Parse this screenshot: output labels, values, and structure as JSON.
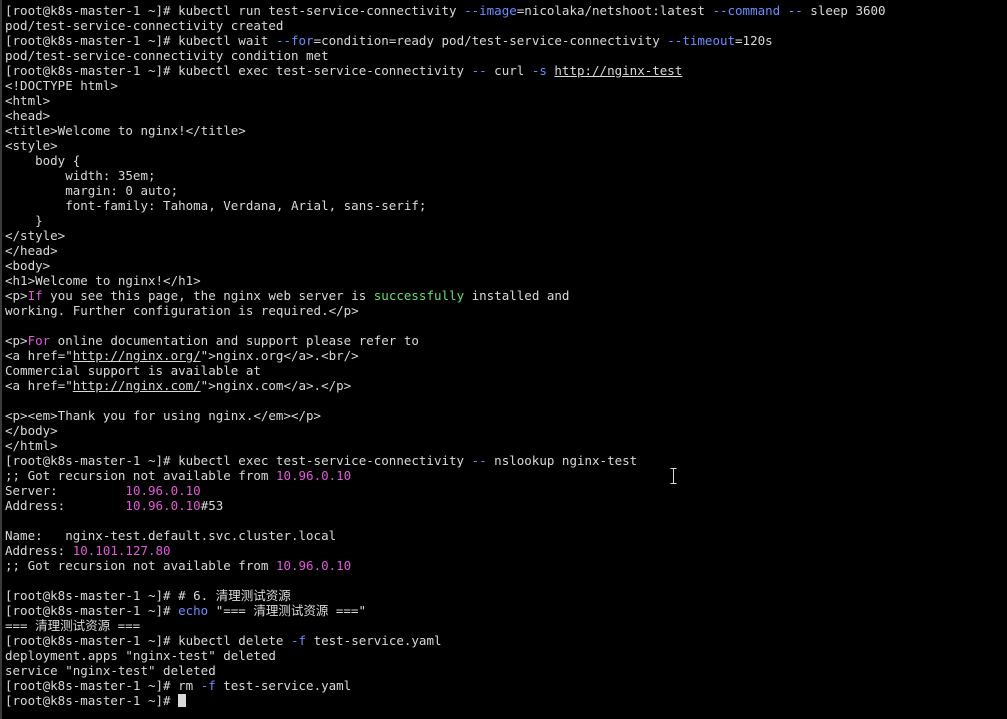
{
  "colors": {
    "background": "#000000",
    "text": "#d9d9d9",
    "option": "#6b8cff",
    "string_green": "#5fe06f",
    "magenta": "#e05ad8",
    "url": "#d9d9d9"
  },
  "icons": {
    "cursor": "text-cursor-ibeam-icon",
    "block_cursor": "terminal-block-cursor"
  },
  "terminal": {
    "lines": [
      [
        {
          "t": "[root@k8s-master-1 ~]# kubectl run test-service-connectivity "
        },
        {
          "t": "--image",
          "c": "option"
        },
        {
          "t": "=nicolaka/netshoot:latest "
        },
        {
          "t": "--command",
          "c": "option"
        },
        {
          "t": " "
        },
        {
          "t": "--",
          "c": "option"
        },
        {
          "t": " sleep 3600"
        }
      ],
      [
        {
          "t": "pod/test-service-connectivity created"
        }
      ],
      [
        {
          "t": "[root@k8s-master-1 ~]# kubectl wait "
        },
        {
          "t": "--for",
          "c": "option"
        },
        {
          "t": "=condition=ready pod/test-service-connectivity "
        },
        {
          "t": "--timeout",
          "c": "option"
        },
        {
          "t": "=120s"
        }
      ],
      [
        {
          "t": "pod/test-service-connectivity condition met"
        }
      ],
      [
        {
          "t": "[root@k8s-master-1 ~]# kubectl exec test-service-connectivity "
        },
        {
          "t": "--",
          "c": "option"
        },
        {
          "t": " curl "
        },
        {
          "t": "-s",
          "c": "option"
        },
        {
          "t": " "
        },
        {
          "t": "http://nginx-test",
          "c": "url"
        }
      ],
      [
        {
          "t": "<!DOCTYPE html>"
        }
      ],
      [
        {
          "t": "<html>"
        }
      ],
      [
        {
          "t": "<head>"
        }
      ],
      [
        {
          "t": "<title>Welcome to nginx!</title>"
        }
      ],
      [
        {
          "t": "<style>"
        }
      ],
      [
        {
          "t": "    body {"
        }
      ],
      [
        {
          "t": "        width: 35em;"
        }
      ],
      [
        {
          "t": "        margin: 0 auto;"
        }
      ],
      [
        {
          "t": "        font-family: Tahoma, Verdana, Arial, sans-serif;"
        }
      ],
      [
        {
          "t": "    }"
        }
      ],
      [
        {
          "t": "</style>"
        }
      ],
      [
        {
          "t": "</head>"
        }
      ],
      [
        {
          "t": "<body>"
        }
      ],
      [
        {
          "t": "<h1>Welcome to nginx!</h1>"
        }
      ],
      [
        {
          "t": "<p>"
        },
        {
          "t": "If",
          "c": "magenta"
        },
        {
          "t": " you see this page, the nginx web server is "
        },
        {
          "t": "successfully",
          "c": "string_green"
        },
        {
          "t": " installed and"
        }
      ],
      [
        {
          "t": "working. Further configuration is required.</p>"
        }
      ],
      [
        {
          "t": ""
        }
      ],
      [
        {
          "t": "<p>"
        },
        {
          "t": "For",
          "c": "magenta"
        },
        {
          "t": " online documentation and support please refer to"
        }
      ],
      [
        {
          "t": "<a href=\""
        },
        {
          "t": "http://nginx.org/",
          "c": "url"
        },
        {
          "t": "\">nginx.org</a>.<br/>"
        }
      ],
      [
        {
          "t": "Commercial support is available at"
        }
      ],
      [
        {
          "t": "<a href=\""
        },
        {
          "t": "http://nginx.com/",
          "c": "url"
        },
        {
          "t": "\">nginx.com</a>.</p>"
        }
      ],
      [
        {
          "t": ""
        }
      ],
      [
        {
          "t": "<p><em>Thank you for using nginx.</em></p>"
        }
      ],
      [
        {
          "t": "</body>"
        }
      ],
      [
        {
          "t": "</html>"
        }
      ],
      [
        {
          "t": "[root@k8s-master-1 ~]# kubectl exec test-service-connectivity "
        },
        {
          "t": "--",
          "c": "option"
        },
        {
          "t": " nslookup nginx-test"
        }
      ],
      [
        {
          "t": ";; Got recursion not available from "
        },
        {
          "t": "10.96.0.10",
          "c": "magenta"
        }
      ],
      [
        {
          "t": "Server:         "
        },
        {
          "t": "10.96.0.10",
          "c": "magenta"
        }
      ],
      [
        {
          "t": "Address:        "
        },
        {
          "t": "10.96.0.10",
          "c": "magenta"
        },
        {
          "t": "#53"
        }
      ],
      [
        {
          "t": ""
        }
      ],
      [
        {
          "t": "Name:   nginx-test.default.svc.cluster.local"
        }
      ],
      [
        {
          "t": "Address: "
        },
        {
          "t": "10.101.127.80",
          "c": "magenta"
        }
      ],
      [
        {
          "t": ";; Got recursion not available from "
        },
        {
          "t": "10.96.0.10",
          "c": "magenta"
        }
      ],
      [
        {
          "t": ""
        }
      ],
      [
        {
          "t": "[root@k8s-master-1 ~]# # 6. 清理测试资源"
        }
      ],
      [
        {
          "t": "[root@k8s-master-1 ~]# "
        },
        {
          "t": "echo",
          "c": "option"
        },
        {
          "t": " \"=== 清理测试资源 ===\""
        }
      ],
      [
        {
          "t": "=== 清理测试资源 ==="
        }
      ],
      [
        {
          "t": "[root@k8s-master-1 ~]# kubectl delete "
        },
        {
          "t": "-f",
          "c": "option"
        },
        {
          "t": " test-service.yaml"
        }
      ],
      [
        {
          "t": "deployment.apps \"nginx-test\" deleted"
        }
      ],
      [
        {
          "t": "service \"nginx-test\" deleted"
        }
      ],
      [
        {
          "t": "[root@k8s-master-1 ~]# rm "
        },
        {
          "t": "-f",
          "c": "option"
        },
        {
          "t": " test-service.yaml"
        }
      ],
      [
        {
          "t": "[root@k8s-master-1 ~]# "
        }
      ]
    ]
  }
}
